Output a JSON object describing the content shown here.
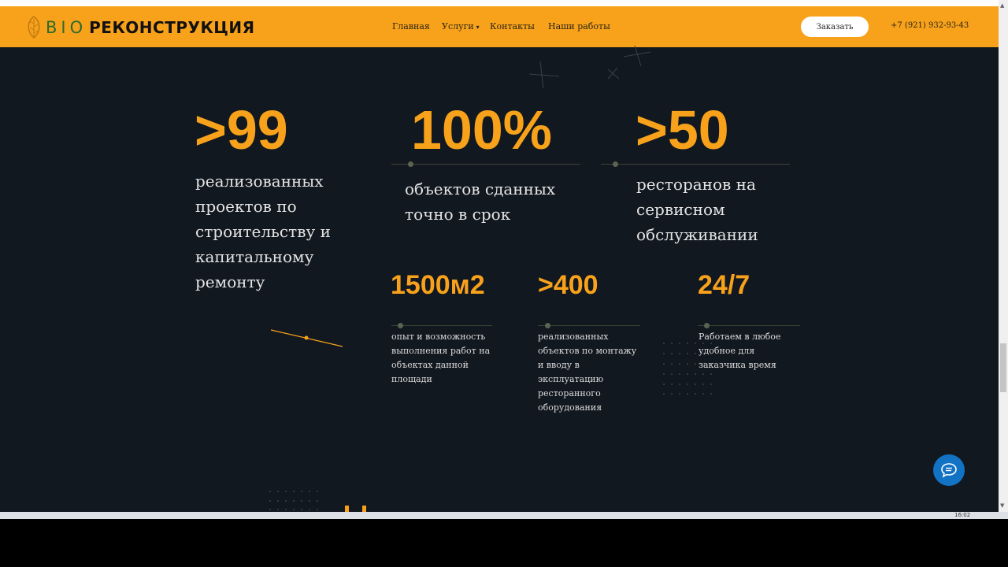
{
  "header": {
    "logo_bio": "ВІО",
    "logo_brand": "РЕКОНСТРУКЦИЯ",
    "nav": [
      {
        "label": "Главная"
      },
      {
        "label": "Услуги",
        "has_dropdown": true
      },
      {
        "label": "Контакты"
      },
      {
        "label": "Наши работы"
      }
    ],
    "order_label": "Заказать",
    "phone": "+7 (921) 932-93-43"
  },
  "stats_big": [
    {
      "value": ">99",
      "text": "реализованных проектов по строительству и капитальному ремонту"
    },
    {
      "value": "100%",
      "text": "объектов сданных точно в срок"
    },
    {
      "value": ">50",
      "text": "ресторанов на сервисном обслуживании"
    }
  ],
  "stats_small": [
    {
      "value": "1500м2",
      "text": "опыт и возможность выполнения работ на объектах данной площади"
    },
    {
      "value": ">400",
      "text": "реализованных объектов по монтажу и вводу в эксплуатацию ресторанного оборудования"
    },
    {
      "value": "24/7",
      "text": "Работаем в любое удобное для заказчика время"
    }
  ],
  "taskbar": {
    "time": "16:02"
  },
  "colors": {
    "accent": "#f8a21b",
    "background": "#121820",
    "chat": "#1273c4",
    "logo_green": "#2c6b2a"
  },
  "icons": [
    "leaf-icon",
    "chevron-down-icon",
    "chat-bubble-icon"
  ]
}
